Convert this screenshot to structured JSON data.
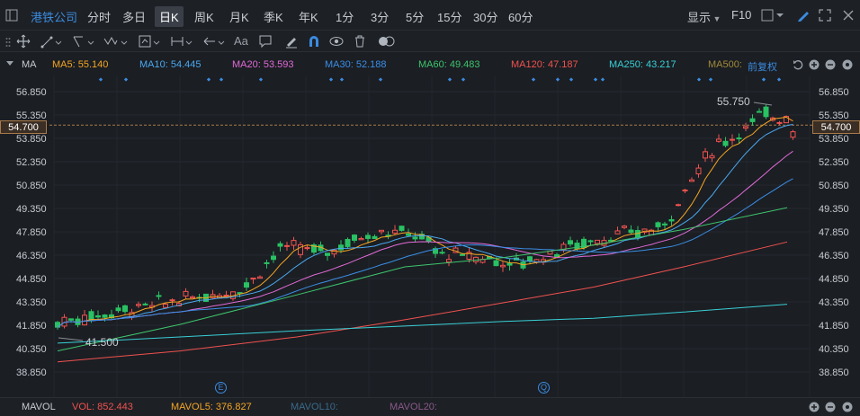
{
  "stock_name": "港铁公司",
  "periods": [
    "分时",
    "多日",
    "日K",
    "周K",
    "月K",
    "季K",
    "年K",
    "1分",
    "3分",
    "5分",
    "15分",
    "30分",
    "60分"
  ],
  "active_period": "日K",
  "display_label": "显示",
  "f10_label": "F10",
  "text_tool_label": "Aa",
  "ma_label": "MA",
  "ma": [
    {
      "label": "MA5: 55.140",
      "color": "#f5a623"
    },
    {
      "label": "MA10: 54.445",
      "color": "#4aa8f0"
    },
    {
      "label": "MA20: 53.593",
      "color": "#e26ad8"
    },
    {
      "label": "MA30: 52.188",
      "color": "#3a8ee6"
    },
    {
      "label": "MA60: 49.483",
      "color": "#3ec46d"
    },
    {
      "label": "MA120: 47.187",
      "color": "#f0524f"
    },
    {
      "label": "MA250: 43.217",
      "color": "#39d0d6"
    },
    {
      "label": "MA500:",
      "color": "#a08a3a"
    }
  ],
  "adjust_label": "前复权",
  "y_labels": [
    "56.850",
    "55.350",
    "53.850",
    "52.350",
    "50.850",
    "49.350",
    "47.850",
    "46.350",
    "44.850",
    "43.350",
    "41.850",
    "40.350",
    "38.850"
  ],
  "current_price": "54.700",
  "high_annotation": "55.750",
  "low_annotation": "41.500",
  "event_markers": [
    "E",
    "Q"
  ],
  "volume": {
    "label": "MAVOL",
    "vol": "VOL: 852.443",
    "mavol5": "MAVOL5: 376.827",
    "mavol10": "MAVOL10:",
    "mavol20": "MAVOL20:"
  },
  "colors": {
    "up": "#f0524f",
    "down": "#29c163",
    "accent": "#3b8be0"
  }
}
